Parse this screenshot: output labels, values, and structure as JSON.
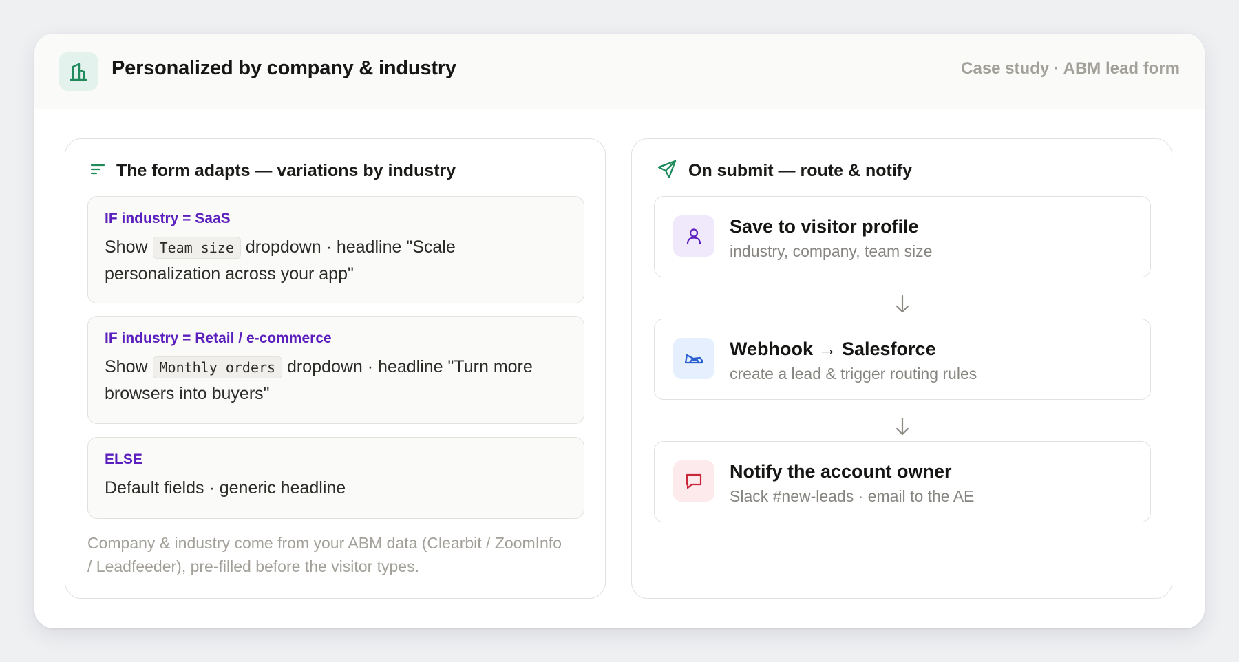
{
  "header": {
    "title": "Personalized by company & industry",
    "meta": "Case study · ABM lead form",
    "logo_icon": "building-icon"
  },
  "left_panel": {
    "title": "The form adapts — variations by industry",
    "icon": "filter-lines-icon",
    "rules": [
      {
        "condition": "IF industry = SaaS",
        "prefix": "Show",
        "field": "Team size",
        "suffix": "dropdown · headline \"Scale personalization across your app\""
      },
      {
        "condition": "IF industry = Retail / e-commerce",
        "prefix": "Show",
        "field": "Monthly orders",
        "suffix": "dropdown · headline \"Turn more browsers into buyers\""
      },
      {
        "condition": "ELSE",
        "text": "Default fields · generic headline"
      }
    ],
    "footnote": "Company & industry come from your ABM data (Clearbit / ZoomInfo / Leadfeeder), pre-filled before the visitor types."
  },
  "right_panel": {
    "title": "On submit — route & notify",
    "icon": "send-icon",
    "steps": [
      {
        "title": "Save to visitor profile",
        "subtitle": "industry, company, team size",
        "icon": "user-icon",
        "icon_color": "#5b1fbe",
        "icon_bg": "#efe9fb"
      },
      {
        "title": "Webhook → Salesforce",
        "subtitle": "create a lead & trigger routing rules",
        "icon": "cloud-icon",
        "icon_color": "#2a5fd0",
        "icon_bg": "#e6effd"
      },
      {
        "title": "Notify the account owner",
        "subtitle": "Slack #new-leads · email to the AE",
        "icon": "message-icon",
        "icon_color": "#c8283a",
        "icon_bg": "#fdeaec"
      }
    ]
  },
  "colors": {
    "accent_green": "#1f8a5c",
    "condition_purple": "#5b1fbe",
    "muted_text": "#a3a099"
  }
}
